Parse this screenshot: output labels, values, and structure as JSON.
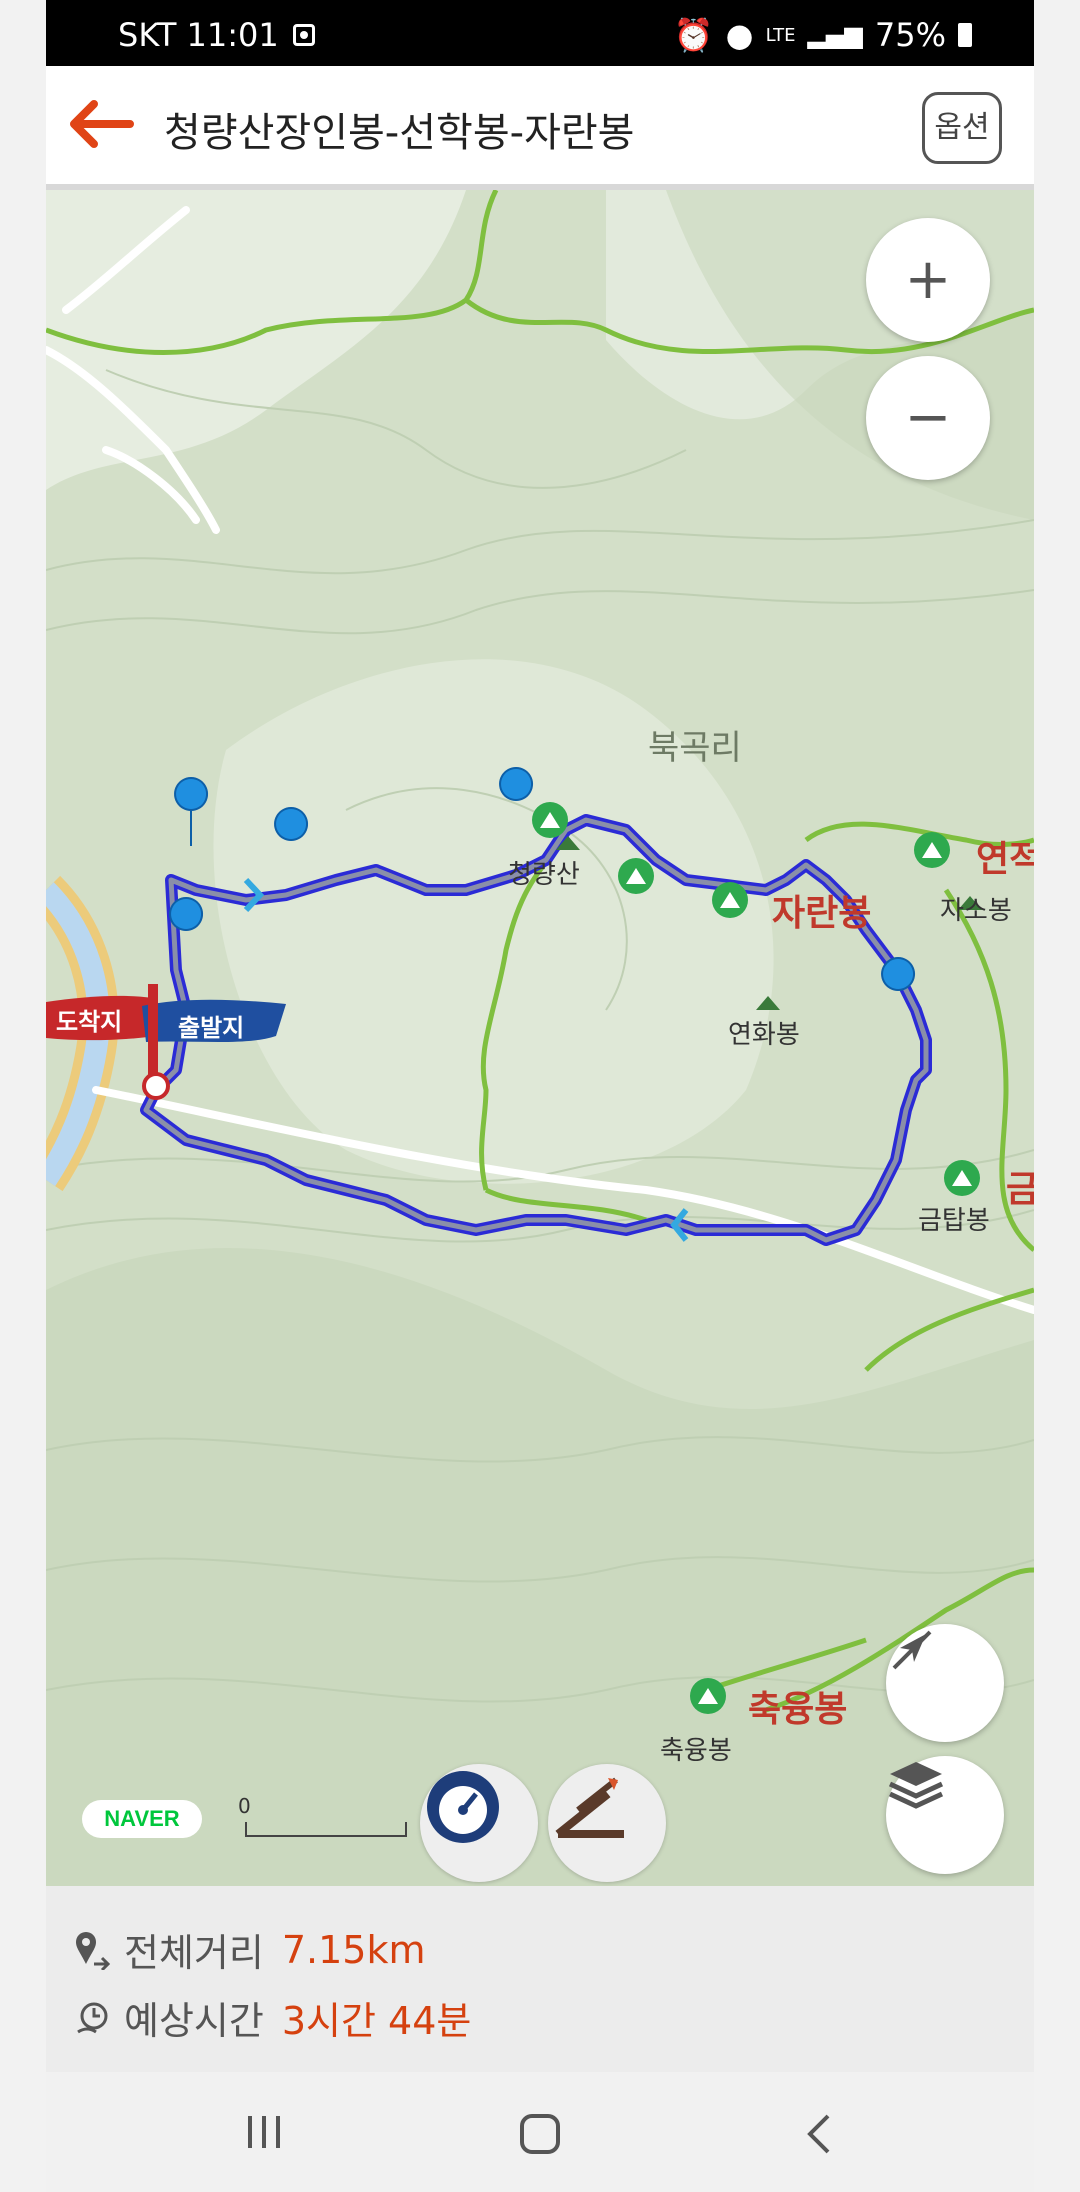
{
  "status_bar": {
    "carrier_time": "SKT 11:01",
    "network": "LTE",
    "battery": "75%"
  },
  "header": {
    "title": "청량산장인봉-선학봉-자란봉",
    "option_button": "옵션"
  },
  "map": {
    "labels": {
      "village": "북곡리",
      "peak_cheongnyang": "청량산",
      "peak_jaran": "자란봉",
      "peak_jaso": "자소봉",
      "peak_yeonhwa": "연화봉",
      "peak_geumtap": "금탑봉",
      "peak_chungnyung": "축융봉",
      "peak_chungnyung_small": "축융봉",
      "peak_yeonjeok_partial": "연적",
      "peak_geum_partial": "금",
      "arrival": "도착지",
      "departure": "출발지"
    },
    "scale_label": "0",
    "provider": "NAVER",
    "route_color": "#2b2bd6"
  },
  "summary": {
    "distance_label": "전체거리",
    "distance_value": "7.15km",
    "time_label": "예상시간",
    "time_value": "3시간 44분"
  }
}
